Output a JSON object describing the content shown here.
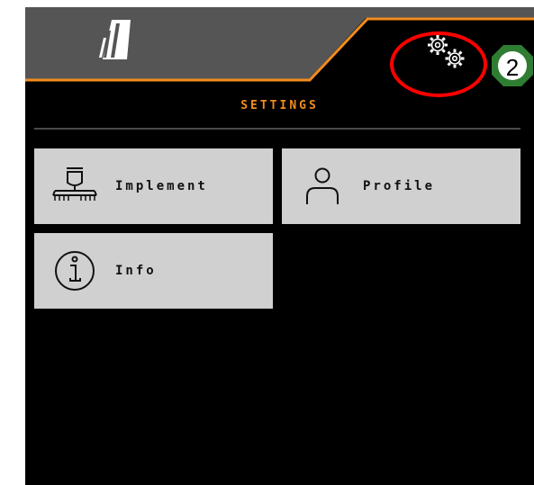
{
  "header": {
    "logo_icon": "tramline-logo-icon",
    "settings_icon": "gears-icon",
    "accent_color": "#f28c1c",
    "header_color": "#555555"
  },
  "callout": {
    "number": "2",
    "ring_color": "#ff0000",
    "badge_color": "#2e7d32"
  },
  "page": {
    "title": "SETTINGS"
  },
  "tiles": [
    {
      "label": "Implement",
      "icon": "implement-icon"
    },
    {
      "label": "Profile",
      "icon": "user-profile-icon"
    },
    {
      "label": "Info",
      "icon": "info-icon"
    }
  ]
}
